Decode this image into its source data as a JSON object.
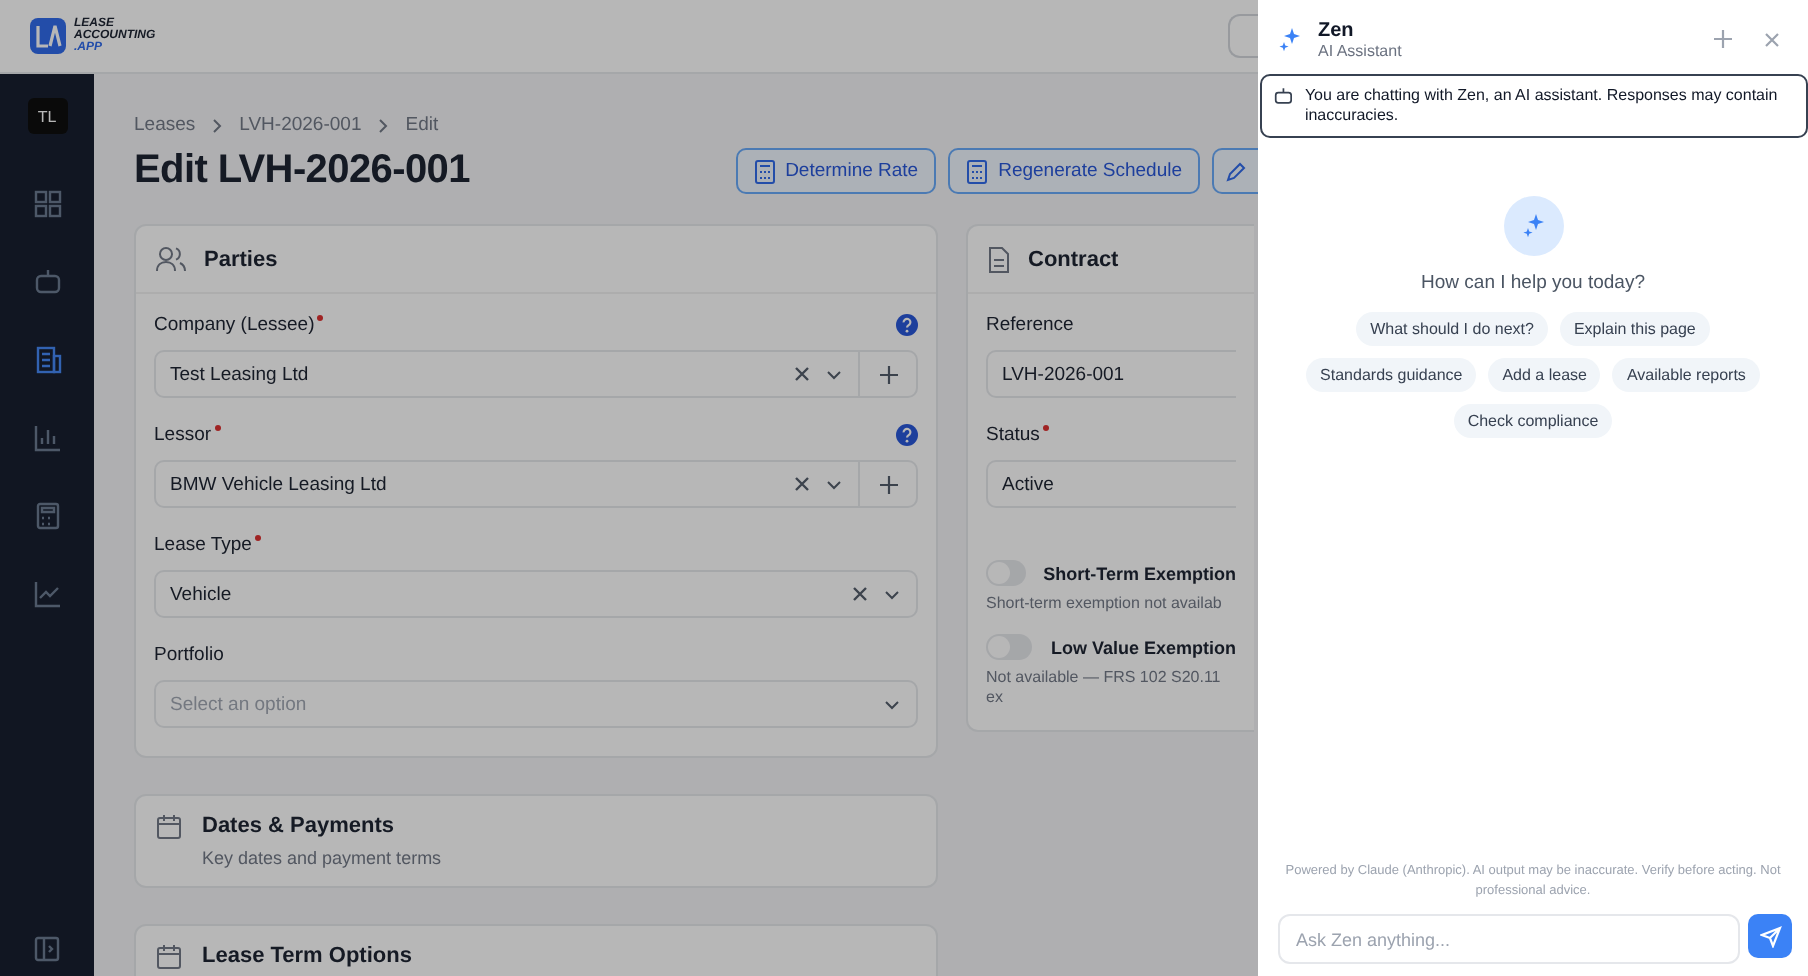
{
  "app": {
    "logo_lines": [
      "LEASE",
      "ACCOUNTING",
      ".APP"
    ]
  },
  "sidebar": {
    "avatar": "TL",
    "items": [
      {
        "selected": false
      },
      {
        "selected": false
      },
      {
        "selected": true
      },
      {
        "selected": false
      },
      {
        "selected": false
      },
      {
        "selected": false
      }
    ]
  },
  "breadcrumb": [
    "Leases",
    "LVH-2026-001",
    "Edit"
  ],
  "page_title": "Edit LVH-2026-001",
  "actions": [
    {
      "label": "Determine Rate"
    },
    {
      "label": "Regenerate Schedule"
    }
  ],
  "parties": {
    "title": "Parties",
    "fields": [
      {
        "label": "Company (Lessee)",
        "required": true,
        "help": true,
        "value": "Test Leasing Ltd",
        "clearable": true,
        "addable": true
      },
      {
        "label": "Lessor",
        "required": true,
        "help": true,
        "value": "BMW Vehicle Leasing Ltd",
        "clearable": true,
        "addable": true
      },
      {
        "label": "Lease Type",
        "required": true,
        "help": false,
        "value": "Vehicle",
        "clearable": true,
        "addable": false
      },
      {
        "label": "Portfolio",
        "required": false,
        "help": false,
        "placeholder": "Select an option",
        "clearable": false,
        "addable": false
      }
    ]
  },
  "contract": {
    "title": "Contract",
    "fields": [
      {
        "label": "Reference",
        "required": false,
        "value": "LVH-2026-001"
      },
      {
        "label": "Status",
        "required": true,
        "value": "Active"
      }
    ],
    "toggles": [
      {
        "label": "Short-Term Exemption",
        "on": false,
        "note": "Short-term exemption not availab"
      },
      {
        "label": "Low Value Exemption",
        "on": false,
        "note": "Not available — FRS 102 S20.11 ex"
      }
    ]
  },
  "sections": [
    {
      "title": "Dates & Payments",
      "subtitle": "Key dates and payment terms"
    },
    {
      "title": "Lease Term Options"
    }
  ],
  "chat": {
    "name": "Zen",
    "role": "AI Assistant",
    "notice": "You are chatting with Zen, an AI assistant. Responses may contain inaccuracies.",
    "greeting": "How can I help you today?",
    "suggestions": [
      [
        "What should I do next?",
        "Explain this page"
      ],
      [
        "Standards guidance",
        "Add a lease",
        "Available reports"
      ],
      [
        "Check compliance"
      ]
    ],
    "disclaimer": "Powered by Claude (Anthropic). AI output may be inaccurate. Verify before acting. Not professional advice.",
    "placeholder": "Ask Zen anything..."
  }
}
